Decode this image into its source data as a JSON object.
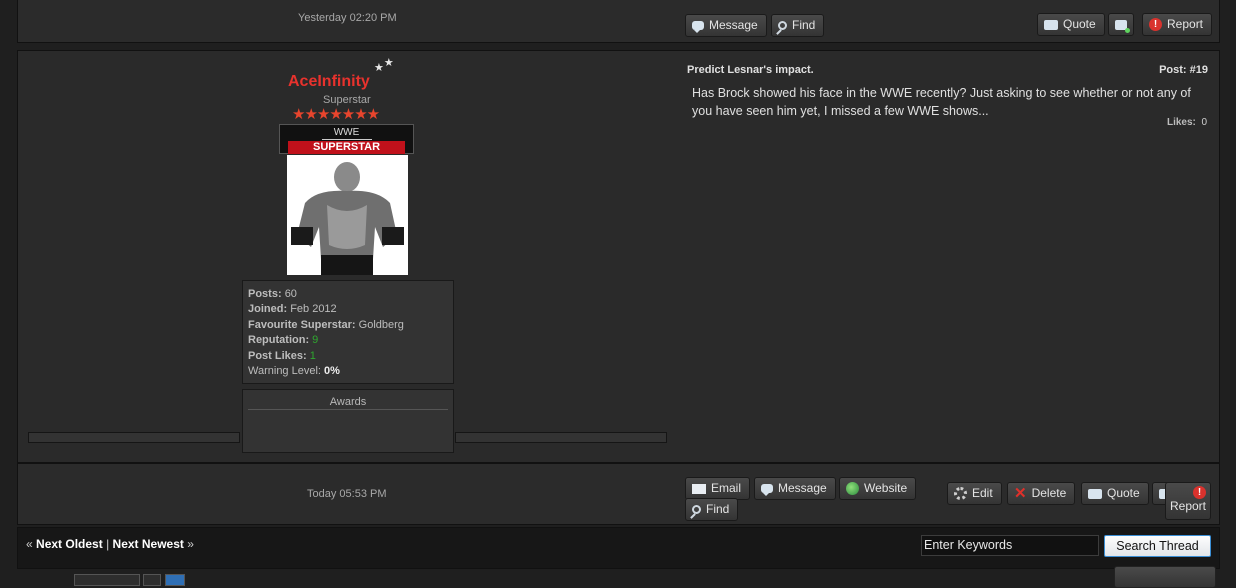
{
  "prev_post": {
    "date": "Yesterday 02:20 PM",
    "buttons": {
      "message": "Message",
      "find": "Find",
      "quote": "Quote",
      "report": "Report"
    }
  },
  "post": {
    "author": {
      "name": "AceInfinity",
      "title": "Superstar",
      "star_count": 7,
      "banner_top": "WWE",
      "banner_bottom": "SUPERSTAR"
    },
    "stats": {
      "posts_label": "Posts:",
      "posts": "60",
      "joined_label": "Joined:",
      "joined": "Feb 2012",
      "fav_label": "Favourite Superstar:",
      "fav": "Goldberg",
      "rep_label": "Reputation:",
      "rep": "9",
      "likes_label": "Post Likes:",
      "likes": "1",
      "warn_label": "Warning Level:",
      "warn": "0%"
    },
    "awards_label": "Awards",
    "subject": "Predict Lesnar's impact.",
    "post_number": "Post: #19",
    "body": "Has Brock showed his face in the WWE recently? Just asking to see whether or not any of you have seen him yet, I missed a few WWE shows...",
    "likes_label": "Likes:",
    "likes_count": "0",
    "date": "Today 05:53 PM",
    "buttons": {
      "email": "Email",
      "message": "Message",
      "website": "Website",
      "find": "Find",
      "edit": "Edit",
      "delete": "Delete",
      "quote": "Quote",
      "report": "Report"
    }
  },
  "nav": {
    "prev_quote": "«",
    "next_oldest": "Next Oldest",
    "sep": "|",
    "next_newest": "Next Newest",
    "next_quote": "»",
    "search_value": "Enter Keywords",
    "search_button": "Search Thread"
  },
  "colors": {
    "username": "#e8322d",
    "accent_star": "#e8452d",
    "green": "#2fa82f"
  }
}
